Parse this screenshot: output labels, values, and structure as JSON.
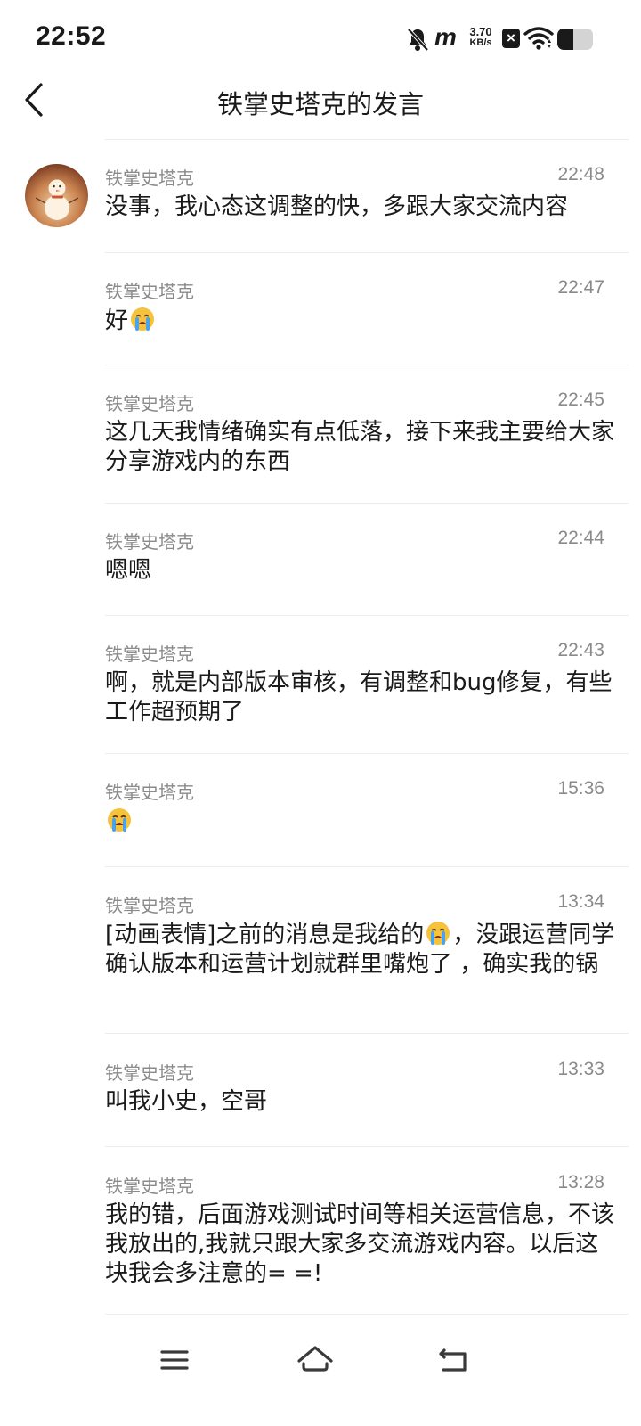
{
  "status_bar": {
    "time": "22:52",
    "network_speed_value": "3.70",
    "network_speed_unit": "KB/s",
    "m_logo": "m",
    "battery_percent": 45,
    "icons": [
      "bell-off-icon",
      "m-logo-icon",
      "x-box-icon",
      "wifi-icon",
      "battery-icon"
    ]
  },
  "header": {
    "title": "铁掌史塔克的发言",
    "back_icon": "chevron-left-icon"
  },
  "messages": [
    {
      "author": "铁掌史塔克",
      "time": "22:48",
      "text": "没事，我心态这调整的快，多跟大家交流内容"
    },
    {
      "author": "铁掌史塔克",
      "time": "22:47",
      "text_before": "好",
      "emoji": "crying-face-icon"
    },
    {
      "author": "铁掌史塔克",
      "time": "22:45",
      "text": "这几天我情绪确实有点低落，接下来我主要给大家分享游戏内的东西"
    },
    {
      "author": "铁掌史塔克",
      "time": "22:44",
      "text": "嗯嗯"
    },
    {
      "author": "铁掌史塔克",
      "time": "22:43",
      "text": "啊，就是内部版本审核，有调整和bug修复，有些工作超预期了"
    },
    {
      "author": "铁掌史塔克",
      "time": "15:36",
      "emoji": "crying-face-icon"
    },
    {
      "author": "铁掌史塔克",
      "time": "13:34",
      "text_before": "[动画表情]之前的消息是我给的",
      "emoji": "crying-face-icon",
      "text_after": "，没跟运营同学确认版本和运营计划就群里嘴炮了 ，确实我的锅"
    },
    {
      "author": "铁掌史塔克",
      "time": "13:33",
      "text": "叫我小史，空哥"
    },
    {
      "author": "铁掌史塔克",
      "time": "13:28",
      "text": "我的错，后面游戏测试时间等相关运营信息，不该我放出的,我就只跟大家多交流游戏内容。以后这块我会多注意的= =!"
    }
  ],
  "nav_bar": {
    "icons": [
      "menu-icon",
      "home-icon",
      "back-arrow-icon"
    ]
  }
}
